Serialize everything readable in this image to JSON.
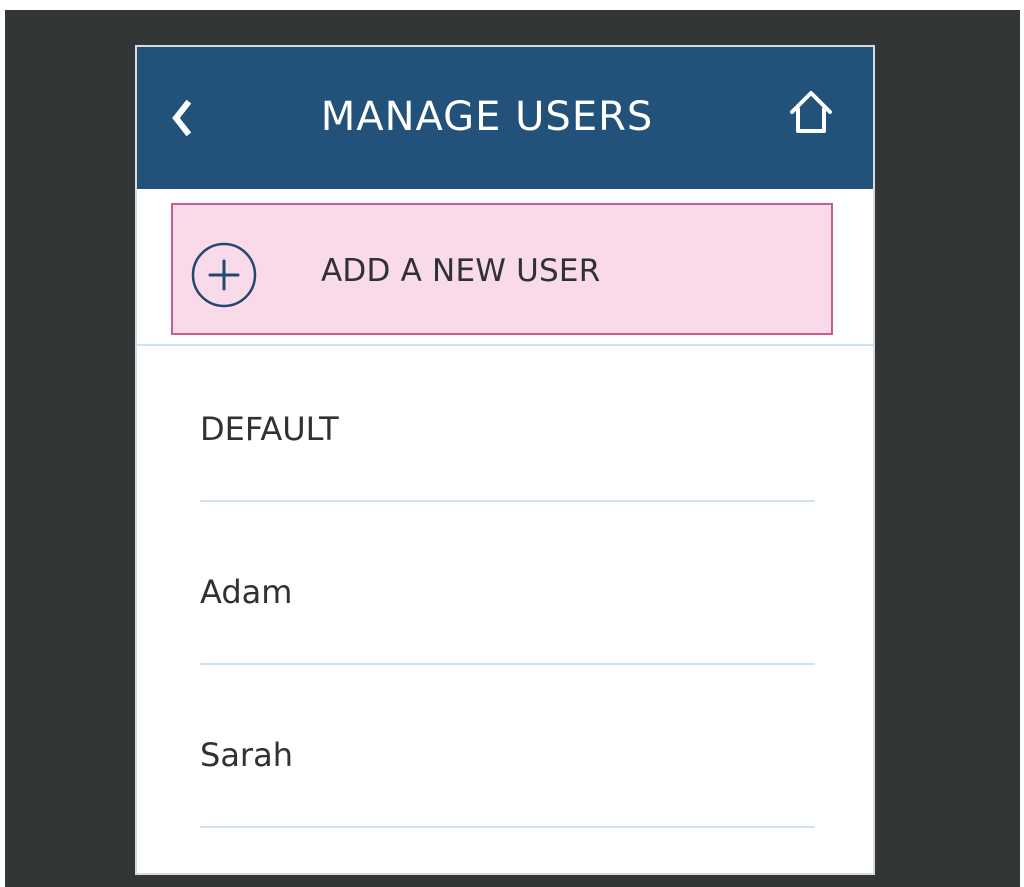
{
  "header": {
    "title": "MANAGE USERS",
    "back_icon": "chevron-left-icon",
    "home_icon": "home-icon"
  },
  "actions": {
    "add_user_label": "ADD A NEW USER",
    "add_icon": "plus-circle-icon"
  },
  "users": [
    {
      "name": "DEFAULT"
    },
    {
      "name": "Adam"
    },
    {
      "name": "Sarah"
    }
  ],
  "colors": {
    "background": "#323637",
    "header": "#22517a",
    "highlight_fill": "#f8dae8",
    "highlight_border": "#c85c95",
    "divider": "#cfe2f3",
    "text": "#2f3133"
  }
}
